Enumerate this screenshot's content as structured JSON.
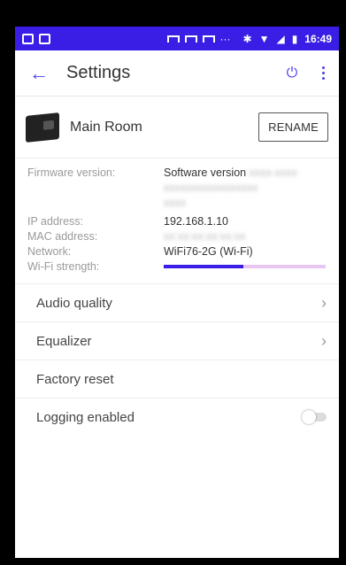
{
  "status_bar": {
    "time": "16:49"
  },
  "app_bar": {
    "title": "Settings"
  },
  "device": {
    "name": "Main Room",
    "rename_label": "RENAME"
  },
  "info": {
    "firmware_label": "Firmware version:",
    "software_value": "Software version",
    "ip_label": "IP address:",
    "ip_value": "192.168.1.10",
    "mac_label": "MAC address:",
    "network_label": "Network:",
    "network_value": "WiFi76-2G (Wi-Fi)",
    "wifi_label": "Wi-Fi strength:",
    "wifi_strength": 0.49
  },
  "list": {
    "audio_quality": "Audio quality",
    "equalizer": "Equalizer",
    "factory_reset": "Factory reset",
    "logging_enabled": "Logging enabled"
  },
  "colors": {
    "accent": "#3a1ee6",
    "bar_bg": "#e9c6f2"
  }
}
